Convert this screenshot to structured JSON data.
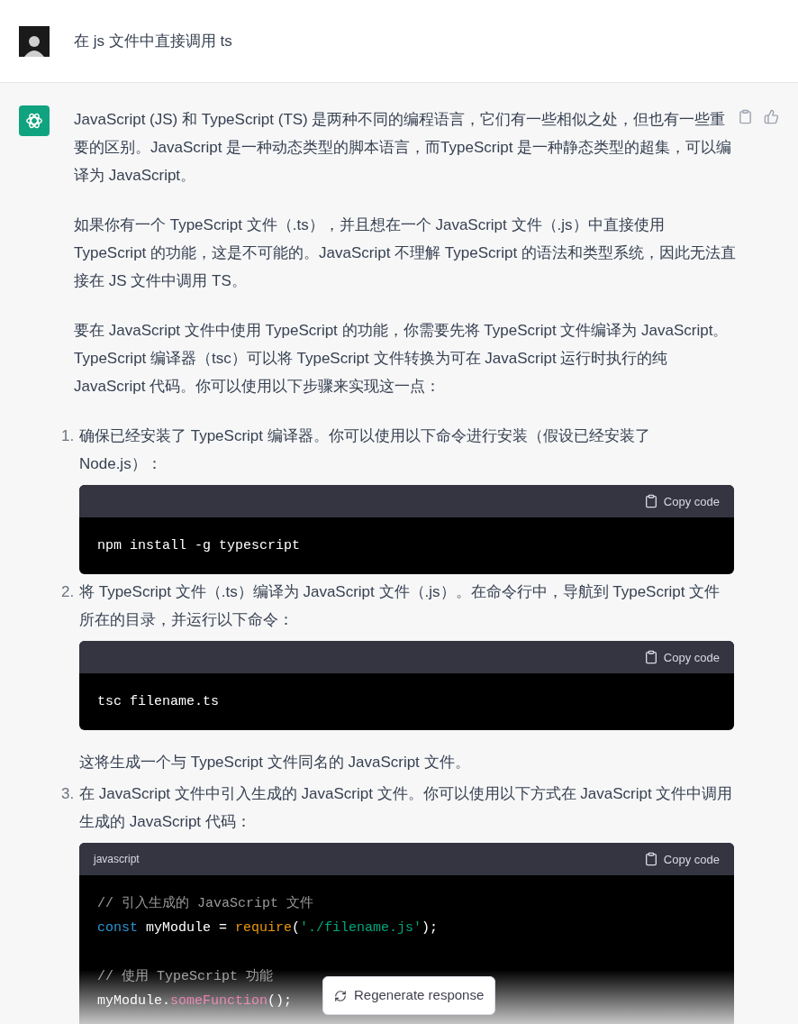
{
  "user_message": {
    "text": "在 js 文件中直接调用 ts"
  },
  "assistant": {
    "paragraphs": [
      "JavaScript (JS) 和 TypeScript (TS) 是两种不同的编程语言，它们有一些相似之处，但也有一些重要的区别。JavaScript 是一种动态类型的脚本语言，而TypeScript 是一种静态类型的超集，可以编译为 JavaScript。",
      "如果你有一个 TypeScript 文件（.ts），并且想在一个 JavaScript 文件（.js）中直接使用 TypeScript 的功能，这是不可能的。JavaScript 不理解 TypeScript 的语法和类型系统，因此无法直接在 JS 文件中调用 TS。",
      "要在 JavaScript 文件中使用 TypeScript 的功能，你需要先将 TypeScript 文件编译为 JavaScript。TypeScript 编译器（tsc）可以将 TypeScript 文件转换为可在 JavaScript 运行时执行的纯 JavaScript 代码。你可以使用以下步骤来实现这一点："
    ],
    "steps": [
      {
        "number": "1.",
        "text": "确保已经安装了 TypeScript 编译器。你可以使用以下命令进行安装（假设已经安装了 Node.js）：",
        "code": {
          "copy_label": "Copy code",
          "lines": [
            {
              "kind": "code",
              "tokens": [
                {
                  "kind": "plain",
                  "text": "npm install -g typescript"
                }
              ]
            }
          ]
        }
      },
      {
        "number": "2.",
        "text": "将 TypeScript 文件（.ts）编译为 JavaScript 文件（.js）。在命令行中，导航到 TypeScript 文件所在的目录，并运行以下命令：",
        "code": {
          "copy_label": "Copy code",
          "lines": [
            {
              "kind": "code",
              "tokens": [
                {
                  "kind": "plain",
                  "text": "tsc filename.ts"
                }
              ]
            }
          ]
        },
        "note": "这将生成一个与 TypeScript 文件同名的 JavaScript 文件。"
      },
      {
        "number": "3.",
        "text": "在 JavaScript 文件中引入生成的 JavaScript 文件。你可以使用以下方式在 JavaScript 文件中调用生成的 JavaScript 代码：",
        "code": {
          "language": "javascript",
          "copy_label": "Copy code",
          "lines": [
            {
              "kind": "code",
              "tokens": [
                {
                  "kind": "comment",
                  "text": "// 引入生成的 JavaScript 文件"
                }
              ]
            },
            {
              "kind": "code",
              "tokens": [
                {
                  "kind": "keyword",
                  "text": "const"
                },
                {
                  "kind": "plain",
                  "text": " myModule = "
                },
                {
                  "kind": "function",
                  "text": "require"
                },
                {
                  "kind": "plain",
                  "text": "("
                },
                {
                  "kind": "string",
                  "text": "'./filename.js'"
                },
                {
                  "kind": "plain",
                  "text": ");"
                }
              ]
            },
            {
              "kind": "blank"
            },
            {
              "kind": "code",
              "tokens": [
                {
                  "kind": "comment",
                  "text": "// 使用 TypeScript 功能"
                }
              ]
            },
            {
              "kind": "code",
              "tokens": [
                {
                  "kind": "plain",
                  "text": "myModule."
                },
                {
                  "kind": "method",
                  "text": "someFunction"
                },
                {
                  "kind": "plain",
                  "text": "();"
                }
              ]
            }
          ]
        }
      }
    ]
  },
  "regenerate_button": {
    "label": "Regenerate response"
  }
}
